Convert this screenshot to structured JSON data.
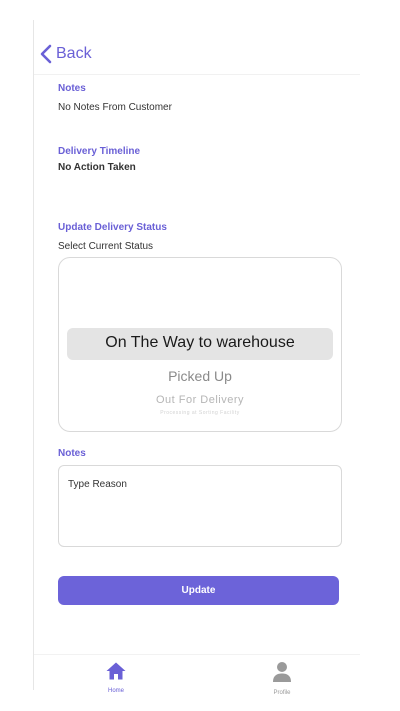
{
  "header": {
    "back_label": "Back"
  },
  "notes_section": {
    "title": "Notes",
    "text": "No Notes From Customer"
  },
  "timeline_section": {
    "title": "Delivery Timeline",
    "text": "No Action Taken"
  },
  "update_section": {
    "title": "Update Delivery Status",
    "subtitle": "Select Current Status",
    "picker_options": [
      "On The Way to warehouse",
      "Picked Up",
      "Out For Delivery",
      "Processing at Sorting Facility"
    ],
    "selected_option": "On The Way to warehouse"
  },
  "reason_section": {
    "title": "Notes",
    "placeholder": "Type Reason"
  },
  "update_button_label": "Update",
  "tabbar": {
    "items": [
      {
        "label": "Home",
        "icon": "home-icon",
        "active": true
      },
      {
        "label": "Profile",
        "icon": "user-icon",
        "active": false
      }
    ]
  },
  "colors": {
    "accent": "#6c63d9",
    "active_tab": "#6a60d6",
    "inactive_tab": "#9a9a9a"
  }
}
